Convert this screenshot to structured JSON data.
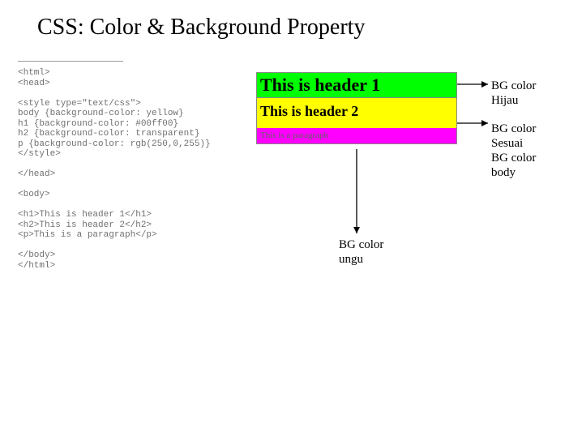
{
  "title": "CSS: Color & Background Property",
  "code": "<html>\n<head>\n\n<style type=\"text/css\">\nbody {background-color: yellow}\nh1 {background-color: #00ff00}\nh2 {background-color: transparent}\np {background-color: rgb(250,0,255)}\n</style>\n\n</head>\n\n<body>\n\n<h1>This is header 1</h1>\n<h2>This is header 2</h2>\n<p>This is a paragraph</p>\n\n</body>\n</html>",
  "render": {
    "h1": "This is header 1",
    "h2": "This is header 2",
    "p": "This is a paragraph"
  },
  "annotations": {
    "a1_l1": "BG color",
    "a1_l2": "Hijau",
    "a2_l1": "BG color",
    "a2_l2": "Sesuai",
    "a2_l3": "BG color",
    "a2_l4": "body",
    "a3_l1": "BG color",
    "a3_l2": "ungu"
  },
  "colors": {
    "body_bg": "#ffff00",
    "h1_bg": "#00ff00",
    "p_bg": "#ff00ff"
  }
}
